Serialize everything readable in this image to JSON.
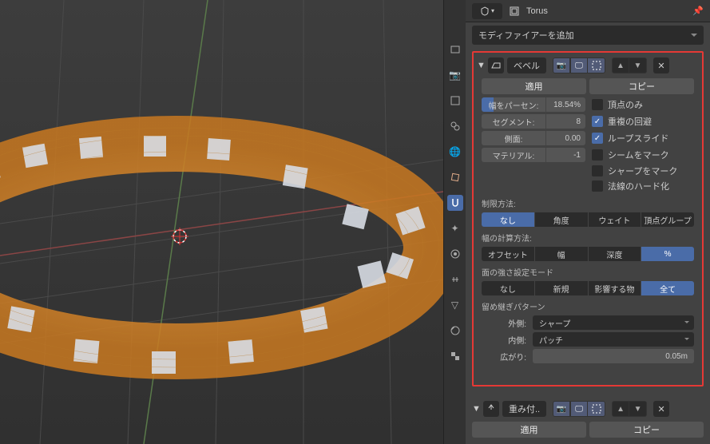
{
  "header": {
    "object_name": "Torus"
  },
  "adder": {
    "label": "モディファイアーを追加"
  },
  "mod1": {
    "name": "ベベル",
    "apply": "適用",
    "copy": "コピー",
    "width_label": "幅をパーセン:",
    "width_val": "18.54%",
    "segments_label": "セグメント:",
    "segments_val": "8",
    "profile_label": "側面:",
    "profile_val": "0.00",
    "material_label": "マテリアル:",
    "material_val": "-1",
    "chk_vertices": "頂点のみ",
    "chk_overlap": "重複の回避",
    "chk_loopslide": "ループスライド",
    "chk_seam": "シームをマーク",
    "chk_sharp": "シャープをマーク",
    "chk_harden": "法線のハード化",
    "limit_label": "制限方法:",
    "limit": {
      "none": "なし",
      "angle": "角度",
      "weight": "ウェイト",
      "vgroup": "頂点グループ"
    },
    "width_method_label": "幅の計算方法:",
    "width_method": {
      "offset": "オフセット",
      "width": "幅",
      "depth": "深度",
      "percent": "%"
    },
    "face_strength_label": "面の強さ設定モード",
    "face_strength": {
      "none": "なし",
      "new": "新規",
      "affected": "影響する物",
      "all": "全て"
    },
    "miter_label": "留め継ぎパターン",
    "outer_label": "外側:",
    "outer_val": "シャープ",
    "inner_label": "内側:",
    "inner_val": "パッチ",
    "spread_label": "広がり:",
    "spread_val": "0.05m"
  },
  "mod2": {
    "name": "重み付..",
    "apply": "適用",
    "copy": "コピー"
  }
}
